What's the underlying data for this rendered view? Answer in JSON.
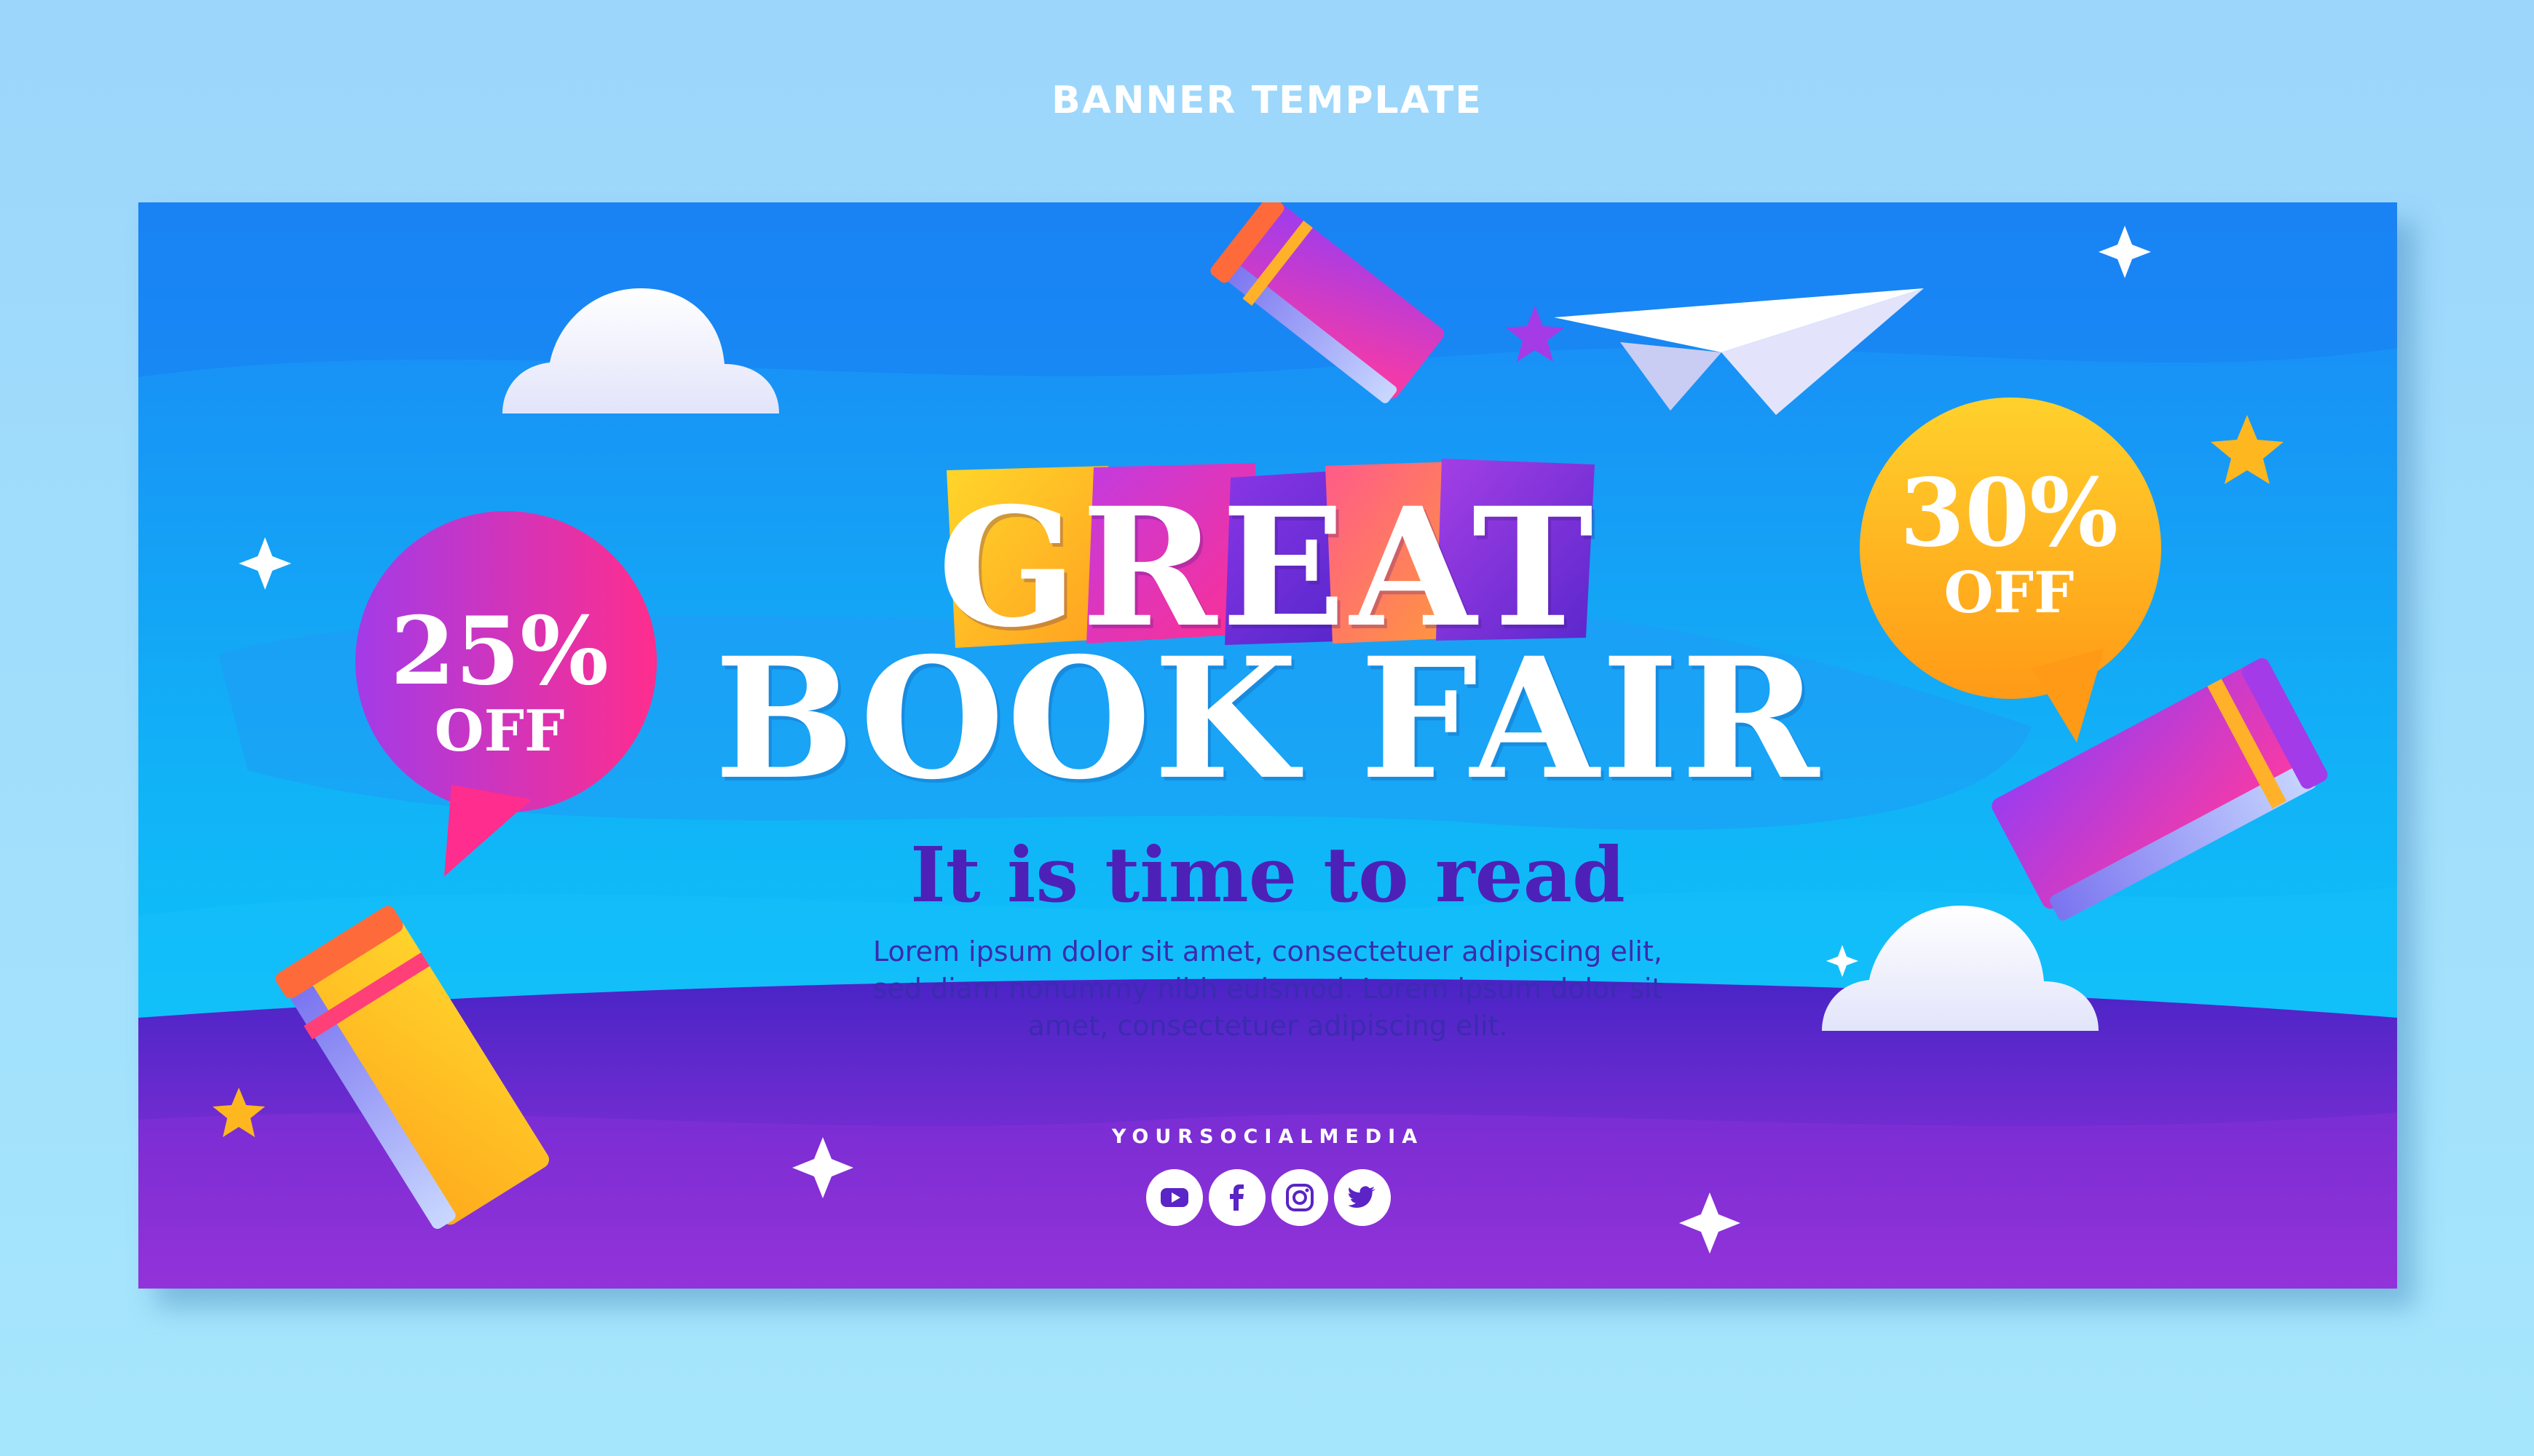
{
  "header": {
    "title": "BANNER TEMPLATE"
  },
  "banner": {
    "headline_top": "GREAT",
    "headline_bottom": "BOOK FAIR",
    "tagline": "It is time to read",
    "body": "Lorem ipsum dolor sit amet, consectetuer adipiscing elit, sed diam nonummy nibh euismod. Lorem ipsum dolor sit amet, consectetuer adipiscing elit.",
    "discount_left": {
      "percent": "25%",
      "label": "OFF"
    },
    "discount_right": {
      "percent": "30%",
      "label": "OFF"
    },
    "social_handle": "YOURSOCIALMEDIA",
    "social_icons": [
      "youtube-icon",
      "facebook-icon",
      "instagram-icon",
      "twitter-icon"
    ]
  },
  "colors": {
    "page_background": "#a6e0fc",
    "sky_top": "#1a86f5",
    "sky_bottom": "#08cffa",
    "hill_purple": "#7b2bd6",
    "tagline": "#4d21b8",
    "body_text": "#3b2bb0",
    "bubble_left_start": "#a33be8",
    "bubble_left_end": "#ff2d8d",
    "bubble_right_start": "#ffcf2a",
    "bubble_right_end": "#ff9a16"
  }
}
